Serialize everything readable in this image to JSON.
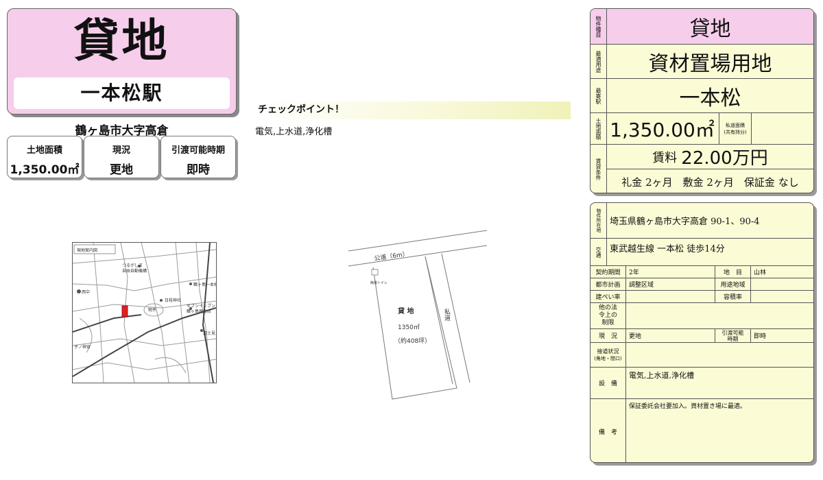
{
  "header": {
    "type": "貸地",
    "station": "一本松駅",
    "address": "鶴ヶ島市大字高倉"
  },
  "tiles": [
    {
      "label": "土地面積",
      "value": "1,350.00㎡"
    },
    {
      "label": "現況",
      "value": "更地"
    },
    {
      "label": "引渡可能時期",
      "value": "即時"
    }
  ],
  "checkpoint": {
    "title": "チェックポイント！",
    "text": "電気,上水道,浄化槽"
  },
  "map": {
    "caption": "現地案内図",
    "labels": [
      "つるがしま",
      "自由自動機構",
      "鶴ヶ島一本松",
      "西中",
      "日枝神社",
      "物件",
      "セブンイレブン",
      "鶴ヶ島高倉店",
      "富士見",
      "子ノ神宮"
    ]
  },
  "plot": {
    "road": "公道（6m）",
    "toilet": "簡易トイレ",
    "private_road": "私道",
    "land_label": "貸 地",
    "area_sqm": "1350㎡",
    "area_tsubo": "（約408坪）"
  },
  "summary": {
    "type_label": "物件種目",
    "type": "貸地",
    "use_label": "最適用途",
    "use": "資材置場用地",
    "station_label": "最寄駅",
    "station": "一本松",
    "area_label": "土地面積",
    "area": "1,350.00㎡",
    "private_road_label": "私道面積",
    "private_road_sub": "(共有持分)",
    "terms_label": "賃貸条件",
    "rent_prefix": "賃料",
    "rent": "22.00万円",
    "fees": "礼金 2ヶ月　敷金 2ヶ月　保証金 なし"
  },
  "details": {
    "location_label": "物件所在地",
    "location": "埼玉県鶴ヶ島市大字高倉 90-1、90-4",
    "transport_label": "交通",
    "transport": "東武越生線 一本松 徒歩14分",
    "contract_label": "契約期間",
    "contract": "2年",
    "chimoku_label": "地　目",
    "chimoku": "山林",
    "city_plan_label": "都市計画",
    "city_plan": "調整区域",
    "zoning_label": "用途地域",
    "zoning": "",
    "bcr_label": "建ぺい率",
    "bcr": "",
    "far_label": "容積率",
    "far": "",
    "restrictions_label": "他の法令上の制限",
    "restrictions": "",
    "status_label": "現　況",
    "status": "更地",
    "handover_label": "引渡可能時期",
    "handover": "即時",
    "road_label": "接道状況",
    "road_sub": "(角地・間口)",
    "road": "",
    "facilities_label": "設　備",
    "facilities": "電気,上水道,浄化槽",
    "remarks_label": "備　考",
    "remarks": "保証委託会社要加入。資材置き場に最適。"
  }
}
